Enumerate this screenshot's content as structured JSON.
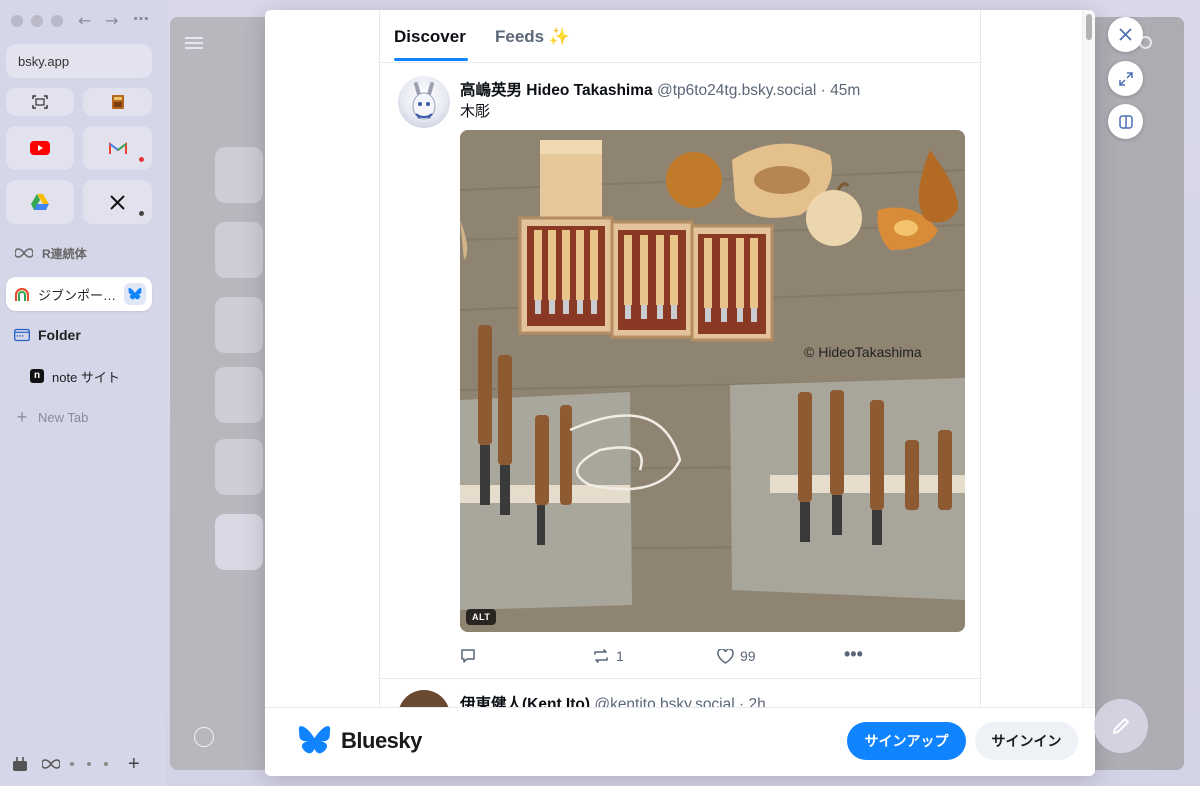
{
  "browser": {
    "url": "bsky.app",
    "sidebar": {
      "space_label": "R連続体",
      "tabs": [
        {
          "label": "ジブンポー…",
          "active": true
        },
        {
          "label": "Folder"
        },
        {
          "label": "note サイト"
        },
        {
          "label": "New Tab"
        }
      ],
      "pinned": [
        {
          "icon": "screenshot-icon"
        },
        {
          "icon": "bookmark-app-icon"
        },
        {
          "icon": "youtube-icon"
        },
        {
          "icon": "gmail-icon"
        },
        {
          "icon": "google-drive-icon"
        },
        {
          "icon": "x-icon"
        }
      ]
    }
  },
  "bluesky": {
    "tabs": [
      {
        "label": "Discover",
        "active": true
      },
      {
        "label": "Feeds ✨"
      }
    ],
    "posts": [
      {
        "author_name": "高嶋英男 Hideo Takashima",
        "handle": "@tp6to24tg.bsky.social · 45m",
        "text": "木彫",
        "image_alt_badge": "ALT",
        "image_watermark": "© HideoTakashima",
        "reply_count": "",
        "repost_count": "1",
        "like_count": "99"
      },
      {
        "author_name": "伊東健人(Kent Ito)",
        "handle": "@kentito.bsky.social · 2h"
      }
    ],
    "footer": {
      "brand": "Bluesky",
      "signup": "サインアップ",
      "signin": "サインイン"
    },
    "accent_color": "#1083fe"
  }
}
